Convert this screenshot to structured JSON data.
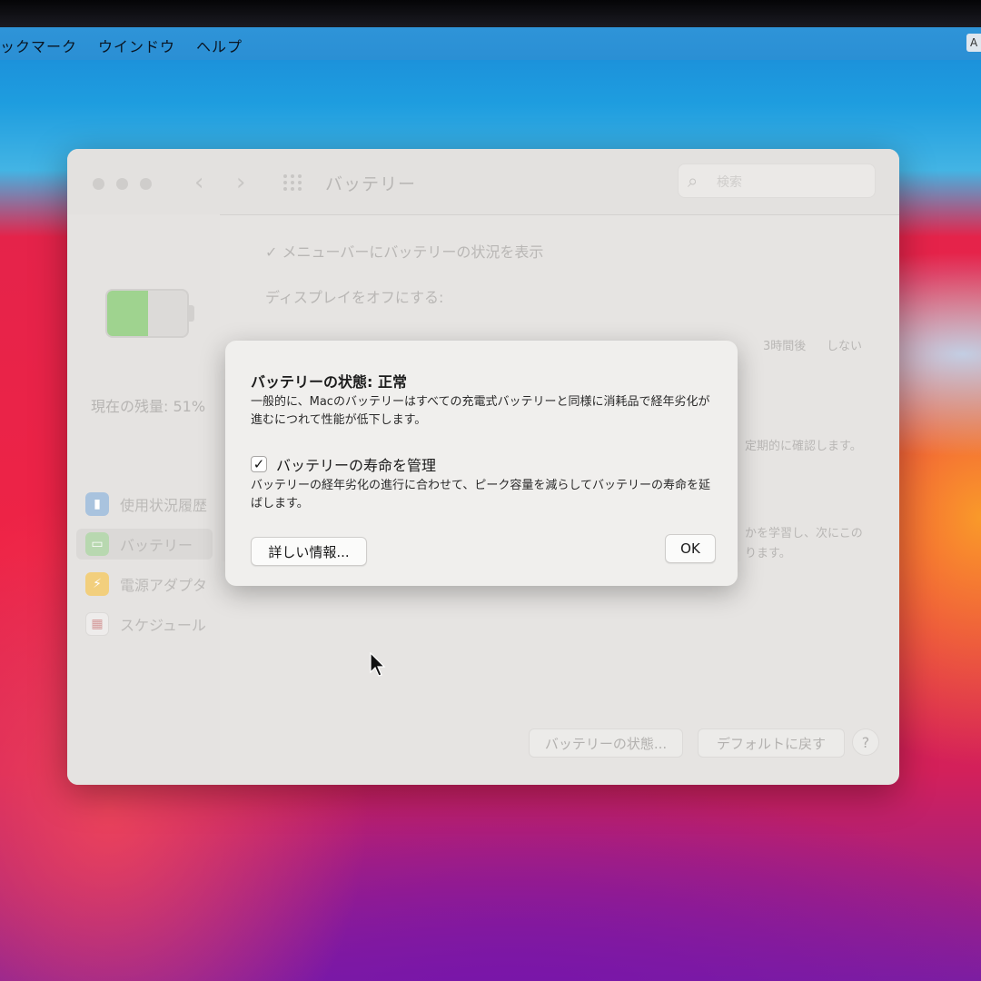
{
  "menubar": {
    "items": [
      "ックマーク",
      "ウインドウ",
      "ヘルプ"
    ],
    "input_indicator": "A"
  },
  "window": {
    "title": "バッテリー",
    "search_placeholder": "検索"
  },
  "sidebar": {
    "battery_level": 0.51,
    "remaining_label": "現在の残量: 51%",
    "items": [
      {
        "label": "使用状況履歴",
        "icon": "chart-icon"
      },
      {
        "label": "バッテリー",
        "icon": "battery-icon"
      },
      {
        "label": "電源アダプタ",
        "icon": "bolt-icon"
      },
      {
        "label": "スケジュール",
        "icon": "calendar-icon"
      }
    ]
  },
  "pane": {
    "menubar_checkbox": "✓ メニューバーにバッテリーの状況を表示",
    "display_off_label": "ディスプレイをオフにする:",
    "slider_end_label": "3時間後",
    "slider_never_label": "しない",
    "partial_text_1": "定期的に確認します。",
    "partial_text_2": "かを学習し、次にこの",
    "partial_text_3": "ります。",
    "battery_health_button": "バッテリーの状態...",
    "restore_defaults_button": "デフォルトに戻す",
    "help_button": "?"
  },
  "sheet": {
    "title": "バッテリーの状態: 正常",
    "body": "一般的に、Macのバッテリーはすべての充電式バッテリーと同様に消耗品で経年劣化が進むにつれて性能が低下します。",
    "checkbox_mark": "✓",
    "checkbox_label": "バッテリーの寿命を管理",
    "checkbox_desc": "バッテリーの経年劣化の進行に合わせて、ピーク容量を減らしてバッテリーの寿命を延ばします。",
    "more_info_button": "詳しい情報...",
    "ok_button": "OK"
  }
}
